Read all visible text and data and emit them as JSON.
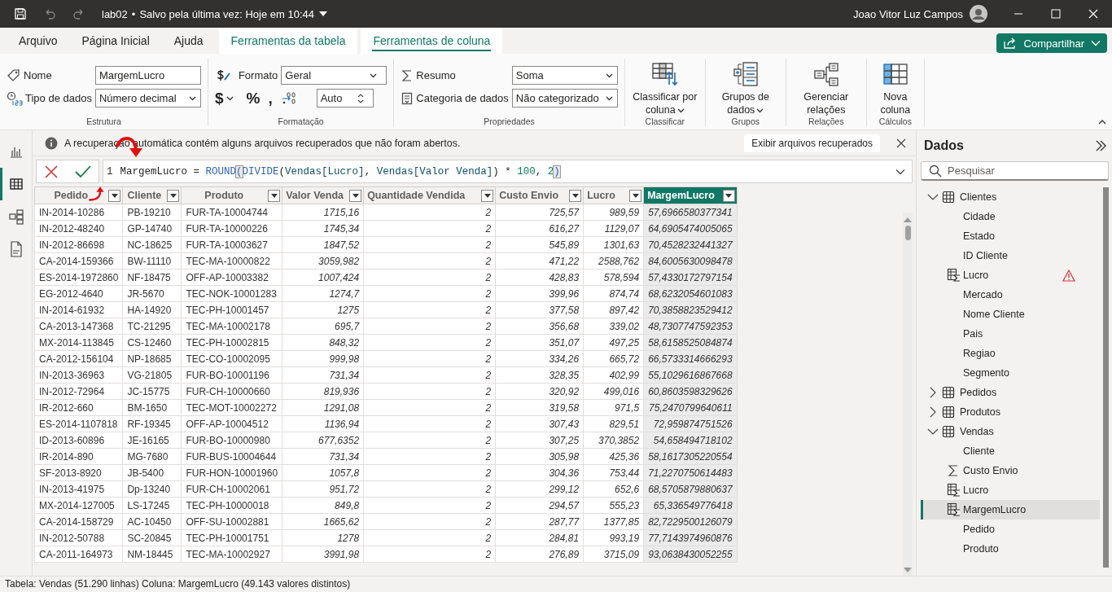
{
  "title_bar": {
    "file_name": "lab02",
    "separator": "•",
    "save_status": "Salvo pela última vez: Hoje em 10:44",
    "user_name": "Joao Vitor Luz Campos"
  },
  "ribbon_tabs": [
    {
      "label": "Arquivo",
      "selected": false,
      "contextual": false
    },
    {
      "label": "Página Inicial",
      "selected": false,
      "contextual": false
    },
    {
      "label": "Ajuda",
      "selected": false,
      "contextual": false
    },
    {
      "label": "Ferramentas da tabela",
      "selected": false,
      "contextual": true
    },
    {
      "label": "Ferramentas de coluna",
      "selected": true,
      "contextual": true
    }
  ],
  "share_button": {
    "label": "Compartilhar"
  },
  "ribbon_groups": [
    {
      "label": "Estrutura",
      "kind": "small",
      "rows": [
        [
          {
            "kind": "field",
            "label": "Nome",
            "value": "MargemLucro"
          }
        ],
        [
          {
            "kind": "dropdown",
            "label": "Tipo de dados",
            "value": "Número decimal"
          }
        ]
      ]
    },
    {
      "label": "Formatação",
      "kind": "format",
      "format": {
        "kind": "dropdown",
        "label": "Formato",
        "value": "Geral"
      },
      "tools": [
        {
          "kind": "symbol",
          "label": "$",
          "has_menu": true
        },
        {
          "kind": "symbol",
          "label": "%",
          "has_menu": false
        },
        {
          "kind": "symbol",
          "label": ",",
          "has_menu": false
        },
        {
          "kind": "icon_button"
        },
        {
          "kind": "spinner",
          "value": "Auto"
        }
      ]
    },
    {
      "label": "Propriedades",
      "kind": "small",
      "rows": [
        [
          {
            "kind": "dropdown",
            "label": "Resumo",
            "value": "Soma"
          }
        ],
        [
          {
            "kind": "dropdown",
            "label": "Categoria de dados",
            "value": "Não categorizado"
          }
        ]
      ]
    },
    {
      "label": "Classificar",
      "kind": "large",
      "button": {
        "label": "Classificar por coluna",
        "has_menu": true
      }
    },
    {
      "label": "Grupos",
      "kind": "large",
      "button": {
        "label": "Grupos de dados",
        "has_menu": true
      }
    },
    {
      "label": "Relações",
      "kind": "large",
      "button": {
        "label": "Gerenciar relações",
        "has_menu": false
      }
    },
    {
      "label": "Cálculos",
      "kind": "large",
      "button": {
        "label": "Nova coluna",
        "has_menu": false
      }
    }
  ],
  "views": [
    {
      "selected": false
    },
    {
      "selected": true
    },
    {
      "selected": false
    },
    {
      "selected": false
    }
  ],
  "info_bar": {
    "message": "A recuperação automática contém alguns arquivos recuperados que não foram abertos.",
    "button": "Exibir arquivos recuperados"
  },
  "formula_bar": {
    "line_number": "1",
    "tokens": [
      {
        "kind": "name",
        "text": "MargemLucro"
      },
      {
        "kind": "operator",
        "text": " = "
      },
      {
        "kind": "function",
        "text": "ROUND"
      },
      {
        "kind": "bracket_match",
        "text": "("
      },
      {
        "kind": "function",
        "text": "DIVIDE"
      },
      {
        "kind": "operator",
        "text": "("
      },
      {
        "kind": "column",
        "text": "Vendas[Lucro]"
      },
      {
        "kind": "operator",
        "text": ", "
      },
      {
        "kind": "column",
        "text": "Vendas[Valor Venda]"
      },
      {
        "kind": "operator",
        "text": ") * "
      },
      {
        "kind": "number",
        "text": "100"
      },
      {
        "kind": "operator",
        "text": ", "
      },
      {
        "kind": "number",
        "text": "2"
      },
      {
        "kind": "bracket_match",
        "text": ")"
      }
    ]
  },
  "table": {
    "columns": [
      {
        "name": "Pedido",
        "numeric": false,
        "selected": false
      },
      {
        "name": "Cliente",
        "numeric": false,
        "selected": false
      },
      {
        "name": "Produto",
        "numeric": false,
        "selected": false
      },
      {
        "name": "Valor Venda",
        "numeric": true,
        "selected": false
      },
      {
        "name": "Quantidade Vendida",
        "numeric": true,
        "selected": false
      },
      {
        "name": "Custo Envio",
        "numeric": true,
        "selected": false
      },
      {
        "name": "Lucro",
        "numeric": true,
        "selected": false
      },
      {
        "name": "MargemLucro",
        "numeric": true,
        "selected": true
      }
    ],
    "rows": [
      [
        "IN-2014-10286",
        "PB-19210",
        "FUR-TA-10004744",
        "1715,16",
        "2",
        "725,57",
        "989,59",
        "57,6966580377341"
      ],
      [
        "IN-2012-48240",
        "GP-14740",
        "FUR-TA-10000226",
        "1745,34",
        "2",
        "616,27",
        "1129,07",
        "64,6905474005065"
      ],
      [
        "IN-2012-86698",
        "NC-18625",
        "FUR-TA-10003627",
        "1847,52",
        "2",
        "545,89",
        "1301,63",
        "70,4528232441327"
      ],
      [
        "CA-2014-159366",
        "BW-11110",
        "TEC-MA-10000822",
        "3059,982",
        "2",
        "471,22",
        "2588,762",
        "84,6005630098478"
      ],
      [
        "ES-2014-1972860",
        "NF-18475",
        "OFF-AP-10003382",
        "1007,424",
        "2",
        "428,83",
        "578,594",
        "57,4330172797154"
      ],
      [
        "EG-2012-4640",
        "JR-5670",
        "TEC-NOK-10001283",
        "1274,7",
        "2",
        "399,96",
        "874,74",
        "68,6232054601083"
      ],
      [
        "IN-2014-61932",
        "HA-14920",
        "TEC-PH-10001457",
        "1275",
        "2",
        "377,58",
        "897,42",
        "70,3858823529412"
      ],
      [
        "CA-2013-147368",
        "TC-21295",
        "TEC-MA-10002178",
        "695,7",
        "2",
        "356,68",
        "339,02",
        "48,7307747592353"
      ],
      [
        "MX-2014-113845",
        "CS-12460",
        "TEC-PH-10002815",
        "848,32",
        "2",
        "351,07",
        "497,25",
        "58,6158525084874"
      ],
      [
        "CA-2012-156104",
        "NP-18685",
        "TEC-CO-10002095",
        "999,98",
        "2",
        "334,26",
        "665,72",
        "66,5733314666293"
      ],
      [
        "IN-2013-36963",
        "VG-21805",
        "FUR-BO-10001196",
        "731,34",
        "2",
        "328,35",
        "402,99",
        "55,1029616867668"
      ],
      [
        "IN-2012-72964",
        "JC-15775",
        "FUR-CH-10000660",
        "819,936",
        "2",
        "320,92",
        "499,016",
        "60,8603598329626"
      ],
      [
        "IR-2012-660",
        "BM-1650",
        "TEC-MOT-10002272",
        "1291,08",
        "2",
        "319,58",
        "971,5",
        "75,2470799640611"
      ],
      [
        "ES-2014-1107818",
        "RF-19345",
        "OFF-AP-10004512",
        "1136,94",
        "2",
        "307,43",
        "829,51",
        "72,959874751526"
      ],
      [
        "ID-2013-60896",
        "JE-16165",
        "FUR-BO-10000980",
        "677,6352",
        "2",
        "307,25",
        "370,3852",
        "54,658494718102"
      ],
      [
        "IR-2014-890",
        "MG-7680",
        "FUR-BUS-10004644",
        "731,34",
        "2",
        "305,98",
        "425,36",
        "58,1617305220554"
      ],
      [
        "SF-2013-8920",
        "JB-5400",
        "FUR-HON-10001960",
        "1057,8",
        "2",
        "304,36",
        "753,44",
        "71,2270750614483"
      ],
      [
        "IN-2013-41975",
        "Dp-13240",
        "FUR-CH-10002061",
        "951,72",
        "2",
        "299,12",
        "652,6",
        "68,5705879880637"
      ],
      [
        "MX-2014-127005",
        "LS-17245",
        "TEC-PH-10000018",
        "849,8",
        "2",
        "294,57",
        "555,23",
        "65,336549776418"
      ],
      [
        "CA-2014-158729",
        "AC-10450",
        "OFF-SU-10002881",
        "1665,62",
        "2",
        "287,77",
        "1377,85",
        "82,7229500126079"
      ],
      [
        "IN-2012-50788",
        "SC-20845",
        "TEC-PH-10001751",
        "1278",
        "2",
        "284,81",
        "993,19",
        "77,7143974960876"
      ],
      [
        "CA-2011-164973",
        "NM-18445",
        "TEC-MA-10002927",
        "3991,98",
        "2",
        "276,89",
        "3715,09",
        "93,0638430052255"
      ]
    ]
  },
  "data_pane": {
    "title": "Dados",
    "search_placeholder": "Pesquisar",
    "tables": [
      {
        "name": "Clientes",
        "expanded": true,
        "children": [
          {
            "name": "Cidade",
            "kind": "column",
            "selected": false,
            "warning": false
          },
          {
            "name": "Estado",
            "kind": "column",
            "selected": false,
            "warning": false
          },
          {
            "name": "ID Cliente",
            "kind": "column",
            "selected": false,
            "warning": false
          },
          {
            "name": "Lucro",
            "kind": "calculated",
            "selected": false,
            "warning": true
          },
          {
            "name": "Mercado",
            "kind": "column",
            "selected": false,
            "warning": false
          },
          {
            "name": "Nome Cliente",
            "kind": "column",
            "selected": false,
            "warning": false
          },
          {
            "name": "Pais",
            "kind": "column",
            "selected": false,
            "warning": false
          },
          {
            "name": "Regiao",
            "kind": "column",
            "selected": false,
            "warning": false
          },
          {
            "name": "Segmento",
            "kind": "column",
            "selected": false,
            "warning": false
          }
        ]
      },
      {
        "name": "Pedidos",
        "expanded": false
      },
      {
        "name": "Produtos",
        "expanded": false
      },
      {
        "name": "Vendas",
        "expanded": true,
        "children": [
          {
            "name": "Cliente",
            "kind": "column",
            "selected": false,
            "warning": false
          },
          {
            "name": "Custo Envio",
            "kind": "measure",
            "selected": false,
            "warning": false
          },
          {
            "name": "Lucro",
            "kind": "calculated",
            "selected": false,
            "warning": false
          },
          {
            "name": "MargemLucro",
            "kind": "calculated",
            "selected": true,
            "warning": false
          },
          {
            "name": "Pedido",
            "kind": "column",
            "selected": false,
            "warning": false
          },
          {
            "name": "Produto",
            "kind": "column",
            "selected": false,
            "warning": false
          }
        ]
      }
    ]
  },
  "status_bar": {
    "text": "Tabela: Vendas (51.290 linhas) Coluna: MargemLucro (49.143 valores distintos)"
  },
  "annotations": [
    {
      "kind": "arrow_down"
    },
    {
      "kind": "arrow_up"
    }
  ]
}
